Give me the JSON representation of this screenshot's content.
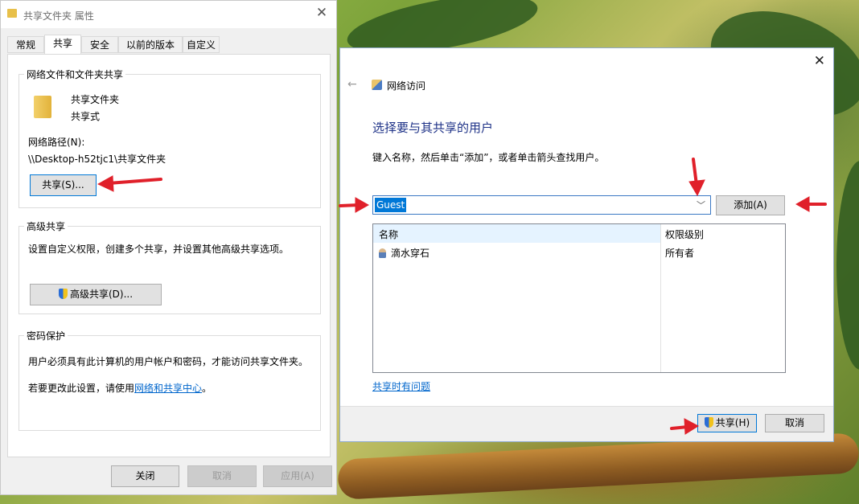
{
  "properties_window": {
    "title": "共享文件夹 属性",
    "tabs": [
      "常规",
      "共享",
      "安全",
      "以前的版本",
      "自定义"
    ],
    "active_tab": "共享",
    "network_sharing": {
      "legend": "网络文件和文件夹共享",
      "folder_name": "共享文件夹",
      "folder_state": "共享式",
      "network_path_label": "网络路径(N):",
      "network_path": "\\\\Desktop-h52tjc1\\共享文件夹",
      "share_button": "共享(S)..."
    },
    "advanced_sharing": {
      "legend": "高级共享",
      "description": "设置自定义权限，创建多个共享，并设置其他高级共享选项。",
      "button": "高级共享(D)..."
    },
    "password_protection": {
      "legend": "密码保护",
      "description": "用户必须具有此计算机的用户帐户和密码，才能访问共享文件夹。",
      "change_prefix": "若要更改此设置，请使用",
      "change_link": "网络和共享中心",
      "change_suffix": "。"
    },
    "buttons": {
      "close": "关闭",
      "cancel": "取消",
      "apply": "应用(A)"
    }
  },
  "network_access": {
    "title": "网络访问",
    "heading": "选择要与其共享的用户",
    "instruction": "键入名称，然后单击“添加”，或者单击箭头查找用户。",
    "input_value": "Guest",
    "add_button": "添加(A)",
    "table": {
      "headers": [
        "名称",
        "权限级别"
      ],
      "rows": [
        {
          "name": "滴水穿石",
          "permission": "所有者"
        }
      ]
    },
    "trouble_link": "共享时有问题",
    "share_button": "共享(H)",
    "cancel_button": "取消"
  },
  "colors": {
    "annotation_arrow": "#e0202a",
    "heading": "#1e3287",
    "link": "#0066cc"
  }
}
